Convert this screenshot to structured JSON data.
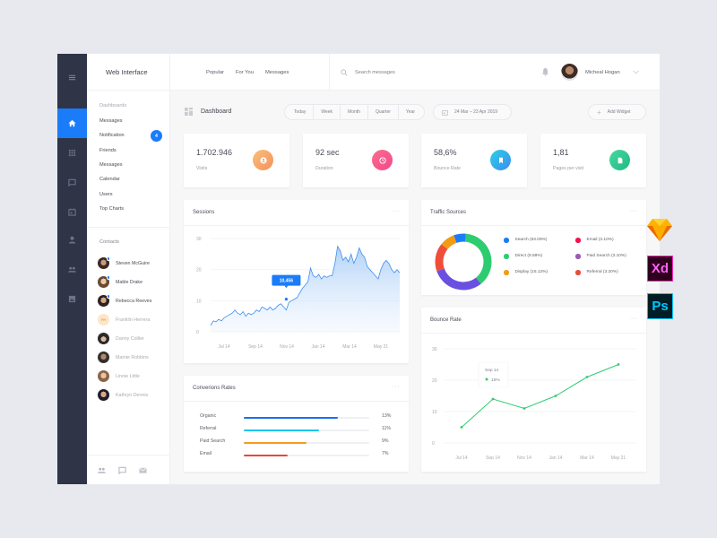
{
  "app": {
    "title": "Web Interface"
  },
  "colors": {
    "accent": "#1a7cf9",
    "rail": "#2f3547",
    "visits_grad": [
      "#f9c07a",
      "#f6905b"
    ],
    "duration_grad": [
      "#fb6f8e",
      "#f3468b"
    ],
    "bounce_grad": [
      "#2bd0e6",
      "#3d8cf0"
    ],
    "pages_grad": [
      "#44d9a0",
      "#22b883"
    ]
  },
  "topbar": {
    "nav": [
      "Popular",
      "For You",
      "Messages"
    ],
    "search_placeholder": "Search messages",
    "user_name": "Micheal Hogan"
  },
  "rail": {
    "items": [
      {
        "icon": "home-icon",
        "active": true
      },
      {
        "icon": "grid-icon",
        "active": false
      },
      {
        "icon": "chat-icon",
        "active": false
      },
      {
        "icon": "calendar-icon",
        "active": false
      },
      {
        "icon": "user-icon",
        "active": false
      },
      {
        "icon": "users-icon",
        "active": false
      },
      {
        "icon": "image-icon",
        "active": false
      }
    ]
  },
  "sidebar": {
    "section_title": "Dashboards",
    "items": [
      {
        "label": "Messages"
      },
      {
        "label": "Notification",
        "badge": "4"
      },
      {
        "label": "Friends"
      },
      {
        "label": "Messages"
      },
      {
        "label": "Calendar"
      },
      {
        "label": "Users"
      },
      {
        "label": "Top Charts"
      }
    ],
    "contacts_title": "Contacts",
    "contacts": [
      {
        "name": "Steven McGuire",
        "online": true
      },
      {
        "name": "Mable Drake",
        "online": true
      },
      {
        "name": "Rebecca Reeves",
        "online": true
      },
      {
        "name": "Franklin Herrera",
        "online": false,
        "initials": "FH"
      },
      {
        "name": "Danny Collier",
        "online": false
      },
      {
        "name": "Mamie Robbins",
        "online": false
      },
      {
        "name": "Linnie Little",
        "online": false
      },
      {
        "name": "Kathryn Dennis",
        "online": false
      }
    ]
  },
  "toolbar": {
    "title": "Dashboard",
    "ranges": [
      "Today",
      "Week",
      "Month",
      "Quarter",
      "Year"
    ],
    "date_range": "24 Mar – 23 Apr 2019",
    "add_widget": "Add Widget"
  },
  "stats": [
    {
      "value": "1.702.946",
      "label": "Visits",
      "icon": "user-circle-icon"
    },
    {
      "value": "92 sec",
      "label": "Duration",
      "icon": "clock-icon"
    },
    {
      "value": "58,6%",
      "label": "Bounce Rate",
      "icon": "bookmark-icon"
    },
    {
      "value": "1,81",
      "label": "Pages per visit",
      "icon": "document-icon"
    }
  ],
  "cards": {
    "sessions_title": "Sessions",
    "traffic_title": "Traffic Sources",
    "conversion_title": "Converions Rates",
    "bounce_title": "Bounce Rate",
    "more_label": "···"
  },
  "conversion": [
    {
      "label": "Organic",
      "value": "13%",
      "fraction": 0.75,
      "color": "#1a6ef5"
    },
    {
      "label": "Referral",
      "value": "11%",
      "fraction": 0.6,
      "color": "#1cc4ee"
    },
    {
      "label": "Paid Search",
      "value": "9%",
      "fraction": 0.5,
      "color": "#f39c1f"
    },
    {
      "label": "Email",
      "value": "7%",
      "fraction": 0.35,
      "color": "#e5483d"
    }
  ],
  "app_icons": [
    "Sketch",
    "Xd",
    "Ps"
  ],
  "chart_data": [
    {
      "type": "area",
      "title": "Sessions",
      "x_ticks": [
        "Jul 14",
        "Sep 14",
        "Nov 14",
        "Jan 14",
        "Mar 14",
        "May 21"
      ],
      "y_ticks": [
        0,
        10,
        20,
        30
      ],
      "ylim": [
        0,
        30
      ],
      "grid": true,
      "tooltip": {
        "label": "10,456",
        "x": 0.4,
        "y": 10.5
      },
      "values": [
        2,
        3.5,
        3.2,
        4,
        3.5,
        4.5,
        5,
        5.5,
        6,
        7,
        6,
        5.5,
        6.5,
        5,
        6,
        5.5,
        6,
        7,
        6.5,
        8,
        7.5,
        7,
        8,
        7,
        7.5,
        8.5,
        9,
        8,
        7,
        9.5,
        10,
        10.5,
        11,
        12.5,
        14,
        15,
        16,
        20.5,
        18,
        17.5,
        18.5,
        17,
        18,
        17.5,
        18,
        18,
        22,
        27.5,
        26,
        23,
        24,
        22.5,
        25,
        22,
        24,
        27,
        25,
        24,
        21,
        20,
        19,
        18,
        17,
        20,
        22,
        23,
        22,
        20,
        19,
        20,
        19
      ]
    },
    {
      "type": "pie",
      "title": "Traffic Sources",
      "donut": true,
      "legend": "right",
      "slices": [
        {
          "label": "Search (63.09%)",
          "value": 6.5,
          "color": "#1a7cf9"
        },
        {
          "label": "Direct (8.58%)",
          "value": 35,
          "color": "#2ecc71"
        },
        {
          "label": "Referral (3.20%)",
          "value": 0,
          "color": "#e74c3c"
        },
        {
          "label": "Paid Search (3.10%)",
          "value": 28,
          "color": "#6b4fe0"
        },
        {
          "label": "Display (15.12%)",
          "value": 15,
          "color": "#ef4e3a"
        },
        {
          "label": "Email (3.10%)",
          "value": 8,
          "color": "#f39c12"
        }
      ],
      "legend_items": [
        {
          "label": "Search (63.09%)",
          "color": "#1a7cf9"
        },
        {
          "label": "Direct (8.58%)",
          "color": "#2ecc71"
        },
        {
          "label": "Display (15.12%)",
          "color": "#f39c12"
        },
        {
          "label": "Email (3.10%)",
          "color": "#f0134d"
        },
        {
          "label": "Paid Search (3.10%)",
          "color": "#9b59b6"
        },
        {
          "label": "Referral (3.20%)",
          "color": "#e74c3c"
        }
      ]
    },
    {
      "type": "line",
      "title": "Bounce Rate",
      "x_ticks": [
        "Jul 14",
        "Sep 14",
        "Nov 14",
        "Jan 14",
        "Mar 14",
        "May 21"
      ],
      "y_ticks": [
        0,
        10,
        20,
        30
      ],
      "ylim": [
        0,
        30
      ],
      "grid": true,
      "values": [
        5,
        14,
        11,
        15,
        21,
        25
      ],
      "color": "#2ecc71",
      "tooltip": {
        "title": "Sep 14",
        "value": "15%"
      }
    }
  ]
}
